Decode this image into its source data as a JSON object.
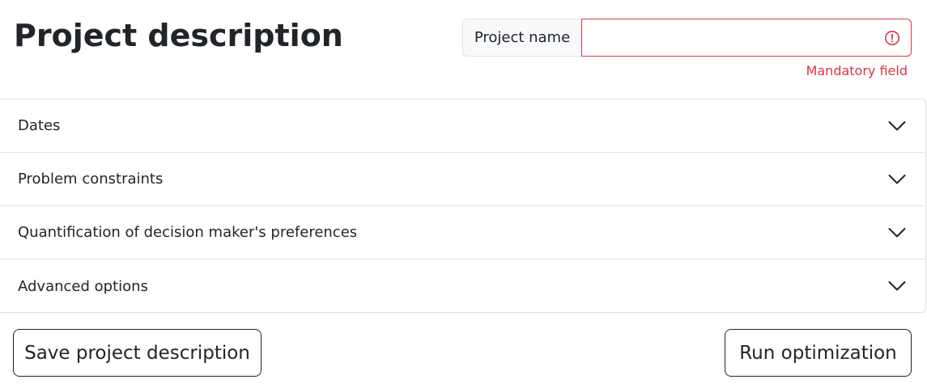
{
  "page": {
    "title": "Project description"
  },
  "project_name": {
    "label": "Project name",
    "value": "",
    "placeholder": "",
    "feedback": "Mandatory field",
    "error_color": "#dc3545"
  },
  "accordion": {
    "items": [
      {
        "label": "Dates",
        "icon": "chevron-down-icon",
        "expanded": false
      },
      {
        "label": "Problem constraints",
        "icon": "chevron-down-icon",
        "expanded": false
      },
      {
        "label": "Quantification of decision maker's preferences",
        "icon": "chevron-down-icon",
        "expanded": false
      },
      {
        "label": "Advanced options",
        "icon": "chevron-down-icon",
        "expanded": false
      }
    ]
  },
  "actions": {
    "save_label": "Save project description",
    "run_label": "Run optimization"
  }
}
